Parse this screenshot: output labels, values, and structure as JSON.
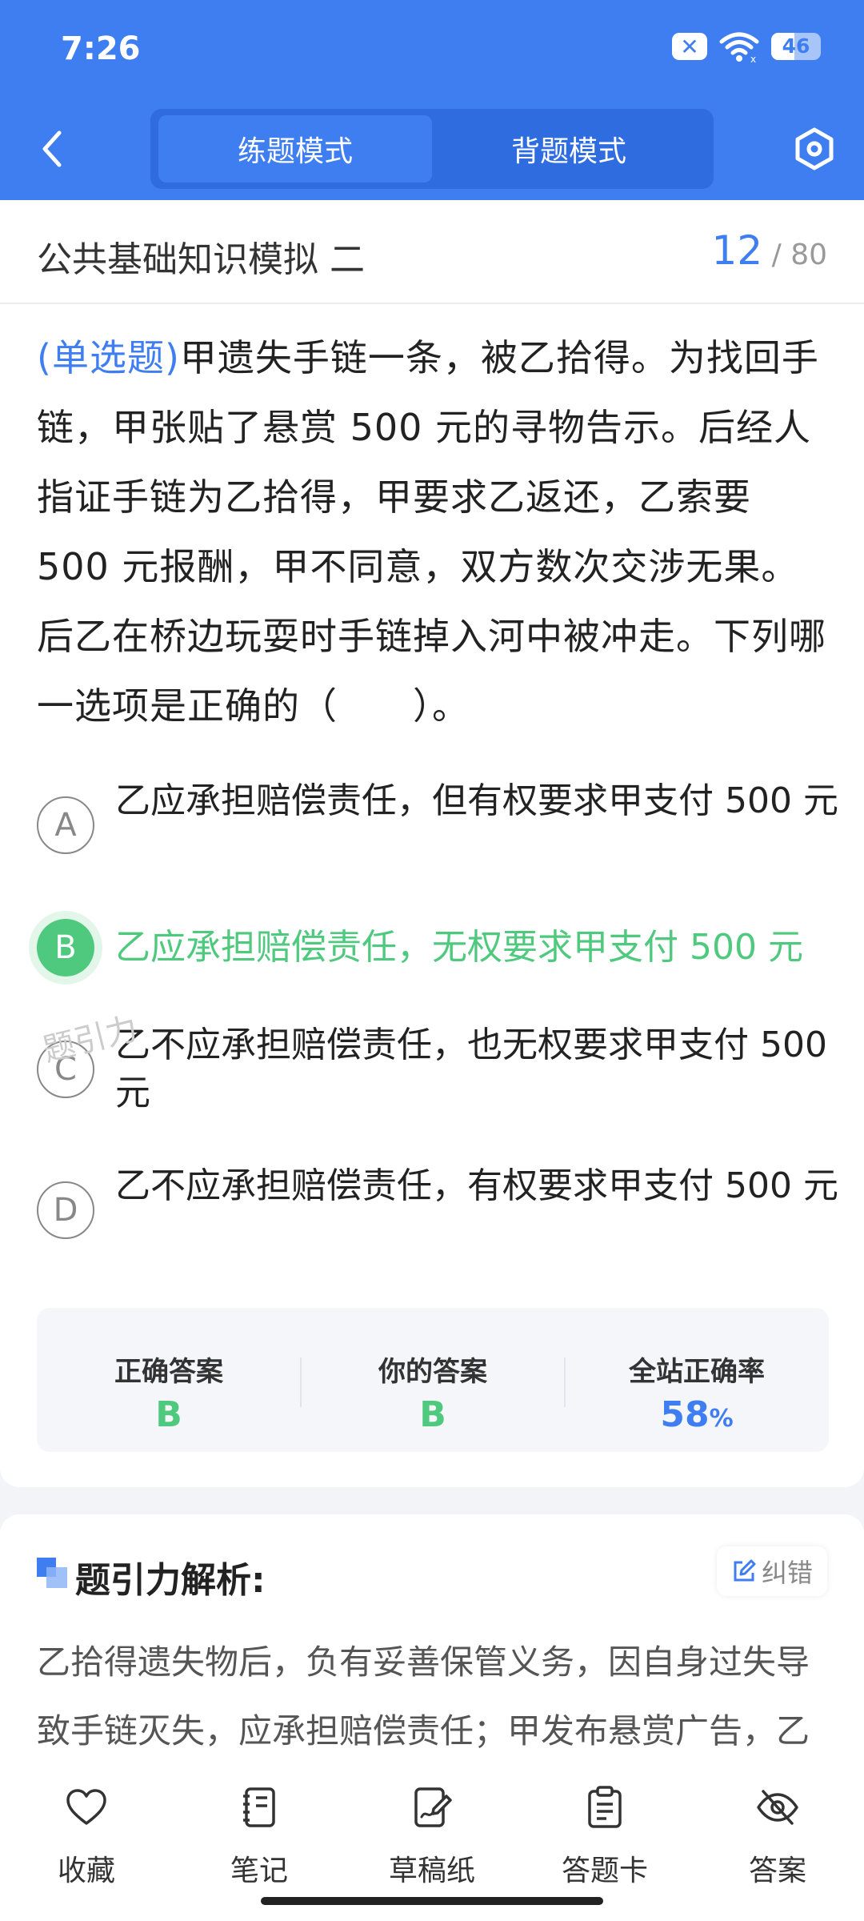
{
  "status_bar": {
    "time": "7:26",
    "x_icon": "✕",
    "battery_level": "46",
    "battery_fraction": 0.46
  },
  "header": {
    "tabs": [
      {
        "label": "练题模式",
        "active": true
      },
      {
        "label": "背题模式",
        "active": false
      }
    ]
  },
  "exam": {
    "title": "公共基础知识模拟 二",
    "current": "12",
    "separator": "/",
    "total": "80"
  },
  "question": {
    "type": "(单选题)",
    "text": "甲遗失手链一条，被乙拾得。为找回手链，甲张贴了悬赏 500 元的寻物告示。后经人指证手链为乙拾得，甲要求乙返还，乙索要 500 元报酬，甲不同意，双方数次交涉无果。后乙在桥边玩耍时手链掉入河中被冲走。下列哪一选项是正确的（　　）。"
  },
  "options": [
    {
      "letter": "A",
      "text": "乙应承担赔偿责任，但有权要求甲支付 500 元"
    },
    {
      "letter": "B",
      "text": "乙应承担赔偿责任，无权要求甲支付 500 元"
    },
    {
      "letter": "C",
      "text": "乙不应承担赔偿责任，也无权要求甲支付 500 元"
    },
    {
      "letter": "D",
      "text": "乙不应承担赔偿责任，有权要求甲支付 500 元"
    }
  ],
  "watermark": "题引力",
  "answer_summary": {
    "correct_label": "正确答案",
    "correct_value": "B",
    "yours_label": "你的答案",
    "yours_value": "B",
    "rate_label": "全站正确率",
    "rate_value": "58",
    "rate_unit": "%"
  },
  "analysis": {
    "title": "题引力解析:",
    "correction_label": "纠错",
    "text": "乙拾得遗失物后，负有妥善保管义务，因自身过失导致手链灭失，应承担赔偿责任；甲发布悬赏广告，乙完成返还行为即有权要求报酬，但乙因自身过错导致"
  },
  "bottom_nav": [
    {
      "label": "收藏",
      "icon": "heart-icon"
    },
    {
      "label": "笔记",
      "icon": "notebook-icon"
    },
    {
      "label": "草稿纸",
      "icon": "draft-paper-icon"
    },
    {
      "label": "答题卡",
      "icon": "answer-card-icon"
    },
    {
      "label": "答案",
      "icon": "eye-off-icon"
    }
  ],
  "colors": {
    "brand": "#3f7ef1",
    "correct": "#4fc97e",
    "accent_dark": "#2f6ce0"
  }
}
